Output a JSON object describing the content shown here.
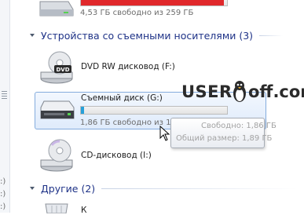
{
  "left_panel": {
    "side_labels": [
      ":)",
      ":)",
      ":)"
    ]
  },
  "drives_top": {
    "free_text": "4,53 ГБ свободно из 259 ГБ",
    "used_fraction": 0.98,
    "bar_color": "#e0282b"
  },
  "group_removable": {
    "title": "Устройства со съемными носителями (3)"
  },
  "dvd_drive": {
    "name": "DVD RW дисковод (F:)",
    "icon": "dvd-drive-icon",
    "badge": "DVD"
  },
  "removable_disk": {
    "name": "Съемный диск (G:)",
    "free_text": "1,86 ГБ свободно из 1,89 ГБ",
    "used_fraction": 0.02,
    "bar_color": "#26a0da",
    "icon": "removable-disk-icon"
  },
  "tooltip": {
    "free_line": "Свободно: 1,86 ГБ",
    "size_line": "Общий размер: 1,89 ГБ"
  },
  "cd_drive": {
    "name": "CD-дисковод (I:)",
    "icon": "cd-drive-icon"
  },
  "group_other": {
    "title": "Другие (2)"
  },
  "other_item": {
    "name": "К"
  },
  "watermark": {
    "text_a": "USER",
    "text_b": "off.com"
  }
}
